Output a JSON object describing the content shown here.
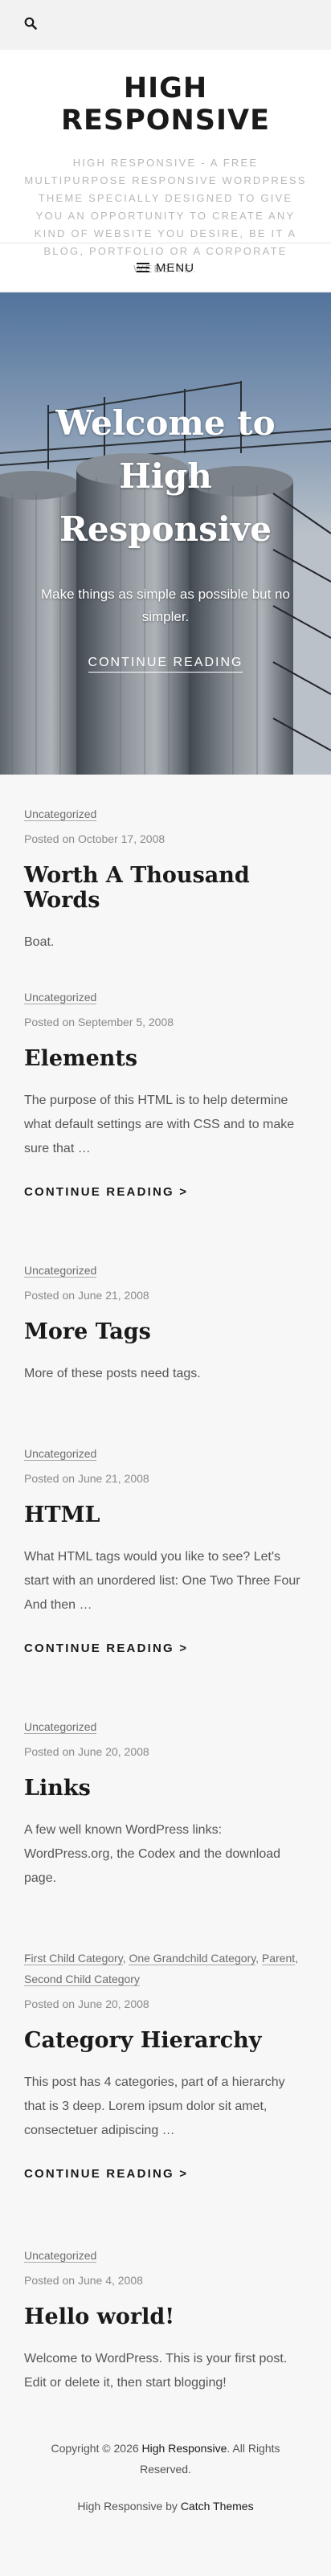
{
  "header": {
    "site_title": "HIGH RESPONSIVE",
    "site_description": "HIGH RESPONSIVE - A FREE MULTIPURPOSE RESPONSIVE WORDPRESS THEME SPECIALLY DESIGNED TO GIVE YOU AN OPPORTUNITY TO CREATE ANY KIND OF WEBSITE YOU DESIRE, BE IT A BLOG, PORTFOLIO OR A CORPORATE WEBSITE."
  },
  "nav": {
    "menu_label": "MENU"
  },
  "hero": {
    "title": "Welcome to High Responsive",
    "subtitle": "Make things as simple as possible but no simpler.",
    "link": "CONTINUE READING"
  },
  "posts": [
    {
      "categories": [
        "Uncategorized"
      ],
      "posted_prefix": "Posted on",
      "date": "October 17, 2008",
      "title": "Worth A Thousand Words",
      "excerpt": "Boat.",
      "readmore": ""
    },
    {
      "categories": [
        "Uncategorized"
      ],
      "posted_prefix": "Posted on",
      "date": "September 5, 2008",
      "title": "Elements",
      "excerpt": "The purpose of this HTML is to help determine what default settings are with CSS and to make sure that …",
      "readmore": "CONTINUE READING >"
    },
    {
      "categories": [
        "Uncategorized"
      ],
      "posted_prefix": "Posted on",
      "date": "June 21, 2008",
      "title": "More Tags",
      "excerpt": "More of these posts need tags.",
      "readmore": ""
    },
    {
      "categories": [
        "Uncategorized"
      ],
      "posted_prefix": "Posted on",
      "date": "June 21, 2008",
      "title": "HTML",
      "excerpt": "What HTML tags would you like to see? Let's start with an unordered list: One Two Three Four And then …",
      "readmore": "CONTINUE READING >"
    },
    {
      "categories": [
        "Uncategorized"
      ],
      "posted_prefix": "Posted on",
      "date": "June 20, 2008",
      "title": "Links",
      "excerpt": "A few well known WordPress links: WordPress.org, the Codex and the download page.",
      "readmore": ""
    },
    {
      "categories": [
        "First Child Category",
        "One Grandchild Category",
        "Parent",
        "Second Child Category"
      ],
      "posted_prefix": "Posted on",
      "date": "June 20, 2008",
      "title": "Category Hierarchy",
      "excerpt": "This post has 4 categories, part of a hierarchy that is 3 deep. Lorem ipsum dolor sit amet, consectetuer adipiscing …",
      "readmore": "CONTINUE READING >"
    },
    {
      "categories": [
        "Uncategorized"
      ],
      "posted_prefix": "Posted on",
      "date": "June 4, 2008",
      "title": "Hello world!",
      "excerpt": "Welcome to WordPress. This is your first post. Edit or delete it, then start blogging!",
      "readmore": ""
    }
  ],
  "footer": {
    "copyright_prefix": "Copyright © 2026",
    "site_name": "High Responsive",
    "rights": ". All Rights Reserved.",
    "theme_name": "High Responsive",
    "by": "by",
    "author": "Catch Themes"
  },
  "colors": {
    "text": "#404040",
    "title": "#1a1a1a",
    "background": "#f7f7f7"
  }
}
